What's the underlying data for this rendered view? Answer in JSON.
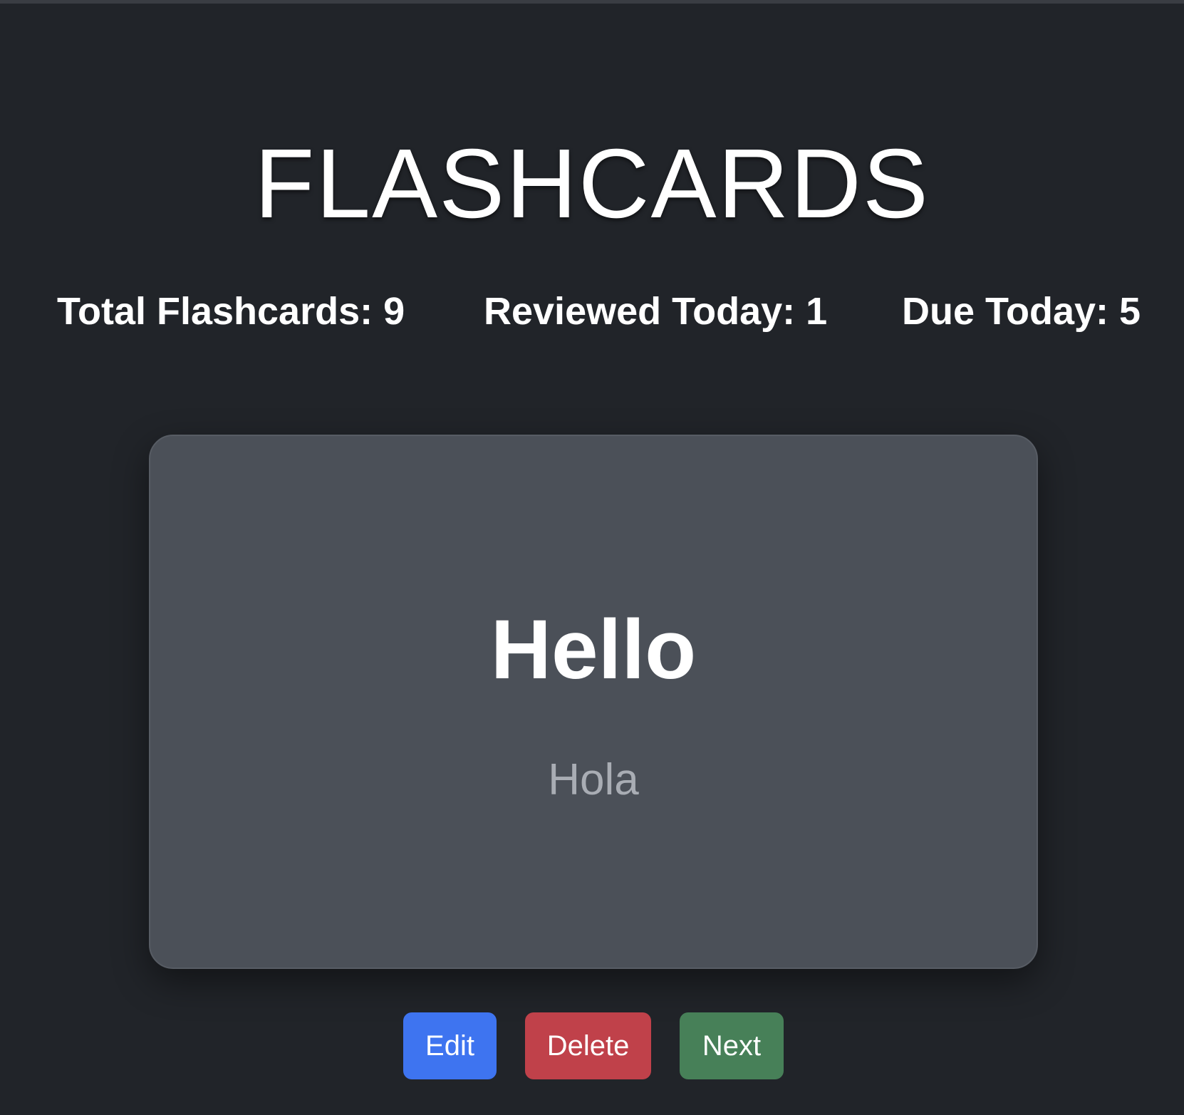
{
  "app": {
    "title": "FLASHCARDS"
  },
  "stats": {
    "total": "Total Flashcards: 9",
    "reviewed": "Reviewed Today: 1",
    "due": "Due Today: 5"
  },
  "card": {
    "front": "Hello",
    "back": "Hola"
  },
  "actions": {
    "edit_label": "Edit",
    "delete_label": "Delete",
    "next_label": "Next"
  },
  "colors": {
    "background": "#212429",
    "card": "#4b5058",
    "edit": "#3e74f0",
    "delete": "#c0414a",
    "next": "#478058"
  }
}
